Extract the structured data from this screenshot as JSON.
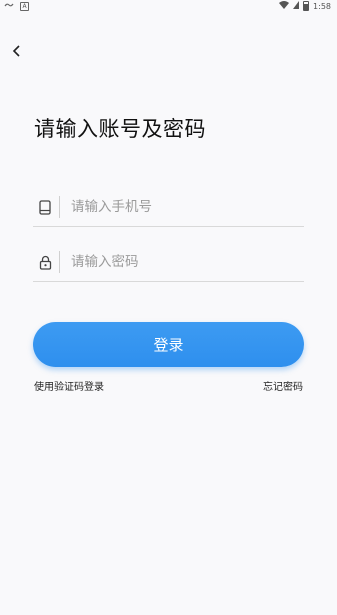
{
  "status_bar": {
    "time": "1:58",
    "left_icons": [
      "link-icon",
      "a-badge-icon"
    ],
    "right_icons": [
      "wifi-icon",
      "sim-icon",
      "battery-icon"
    ]
  },
  "page": {
    "title": "请输入账号及密码"
  },
  "form": {
    "phone": {
      "placeholder": "请输入手机号",
      "value": "",
      "icon": "phone-icon"
    },
    "password": {
      "placeholder": "请输入密码",
      "value": "",
      "icon": "lock-icon"
    },
    "login_label": "登录",
    "sms_login_label": "使用验证码登录",
    "forgot_label": "忘记密码"
  },
  "colors": {
    "accent": "#2e8fee",
    "background": "#f9f9fb"
  }
}
